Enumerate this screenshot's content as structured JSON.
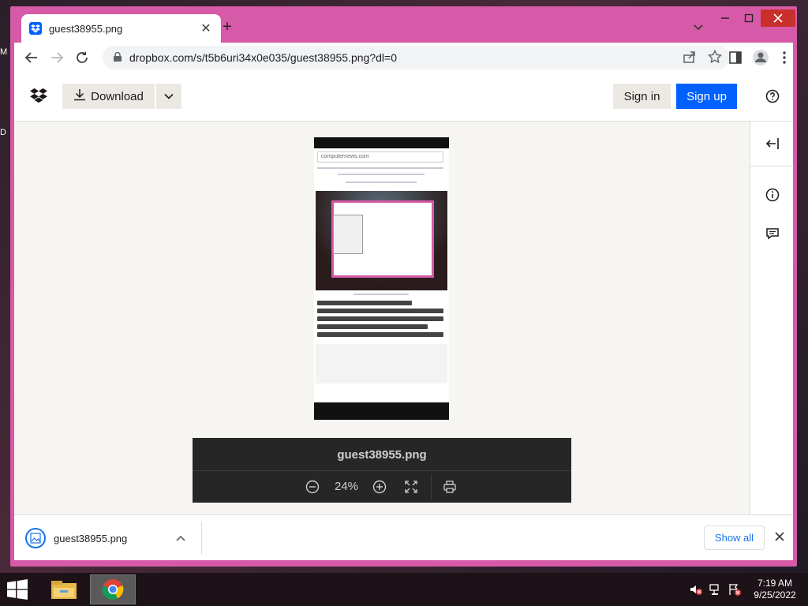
{
  "desktop": {
    "edge_glyphs": [
      "M",
      "D"
    ]
  },
  "browser": {
    "tab": {
      "title": "guest38955.png",
      "close": "✕"
    },
    "new_tab": "+",
    "url": "dropbox.com/s/t5b6uri34x0e035/guest38955.png?dl=0"
  },
  "dropbox": {
    "download_label": "Download",
    "signin_label": "Sign in",
    "signup_label": "Sign up",
    "accent_color": "#0061fe"
  },
  "preview": {
    "url_text": "computernews.com"
  },
  "viewer_controls": {
    "filename": "guest38955.png",
    "zoom": "24%"
  },
  "download_shelf": {
    "file_name": "guest38955.png",
    "show_all_label": "Show all"
  },
  "taskbar": {
    "time": "7:19 AM",
    "date": "9/25/2022"
  }
}
